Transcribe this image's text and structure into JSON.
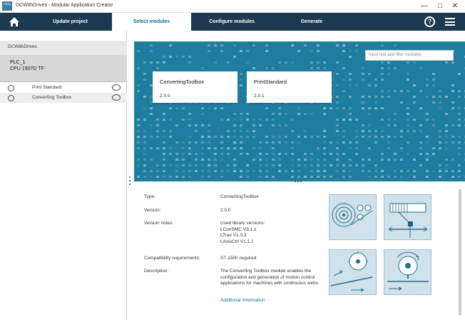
{
  "window": {
    "title": "DCWithDrives - Modular Application Creator",
    "logo_text": "SIEM"
  },
  "nav": {
    "tabs": [
      {
        "label": "Update project"
      },
      {
        "label": "Select modules"
      },
      {
        "label": "Configure modules"
      },
      {
        "label": "Generate"
      }
    ],
    "help": "?"
  },
  "sidebar": {
    "project": "DCWithDrives",
    "plc_name": "PLC_1",
    "plc_cpu": "CPU 1507D TF",
    "modules": [
      {
        "label": "Print Standard"
      },
      {
        "label": "Converting Toolbox"
      }
    ]
  },
  "module_list": {
    "search_placeholder": "Input text and filter modules",
    "cards": [
      {
        "name": "ConvertingToolbox",
        "version": "2.0.0"
      },
      {
        "name": "PrintStandard",
        "version": "2.0.1"
      }
    ]
  },
  "details": {
    "type_label": "Type:",
    "type_value": "ConvertingToolbox",
    "version_label": "Version:",
    "version_value": "2.0.0",
    "notes_label": "Version notes:",
    "notes_lines": [
      "Used library versions:",
      "LConSMC V3.1.1",
      "LTrav V1.0.3",
      "LAxisCtrl V1.1.1"
    ],
    "compat_label": "Compatibility requirements:",
    "compat_value": "S7-1500 required",
    "desc_label": "Description:",
    "desc_lines": [
      "The Converting Toolbox module enables the",
      "configuration and generation of motion control",
      "applications for machines with continuous webs."
    ],
    "more_link": "Additional information"
  },
  "colors": {
    "nav_bg": "#1b3a50",
    "active_tab_text": "#0b6e8c",
    "banner_bg": "#1f7ea0",
    "link": "#0a6ea0"
  }
}
